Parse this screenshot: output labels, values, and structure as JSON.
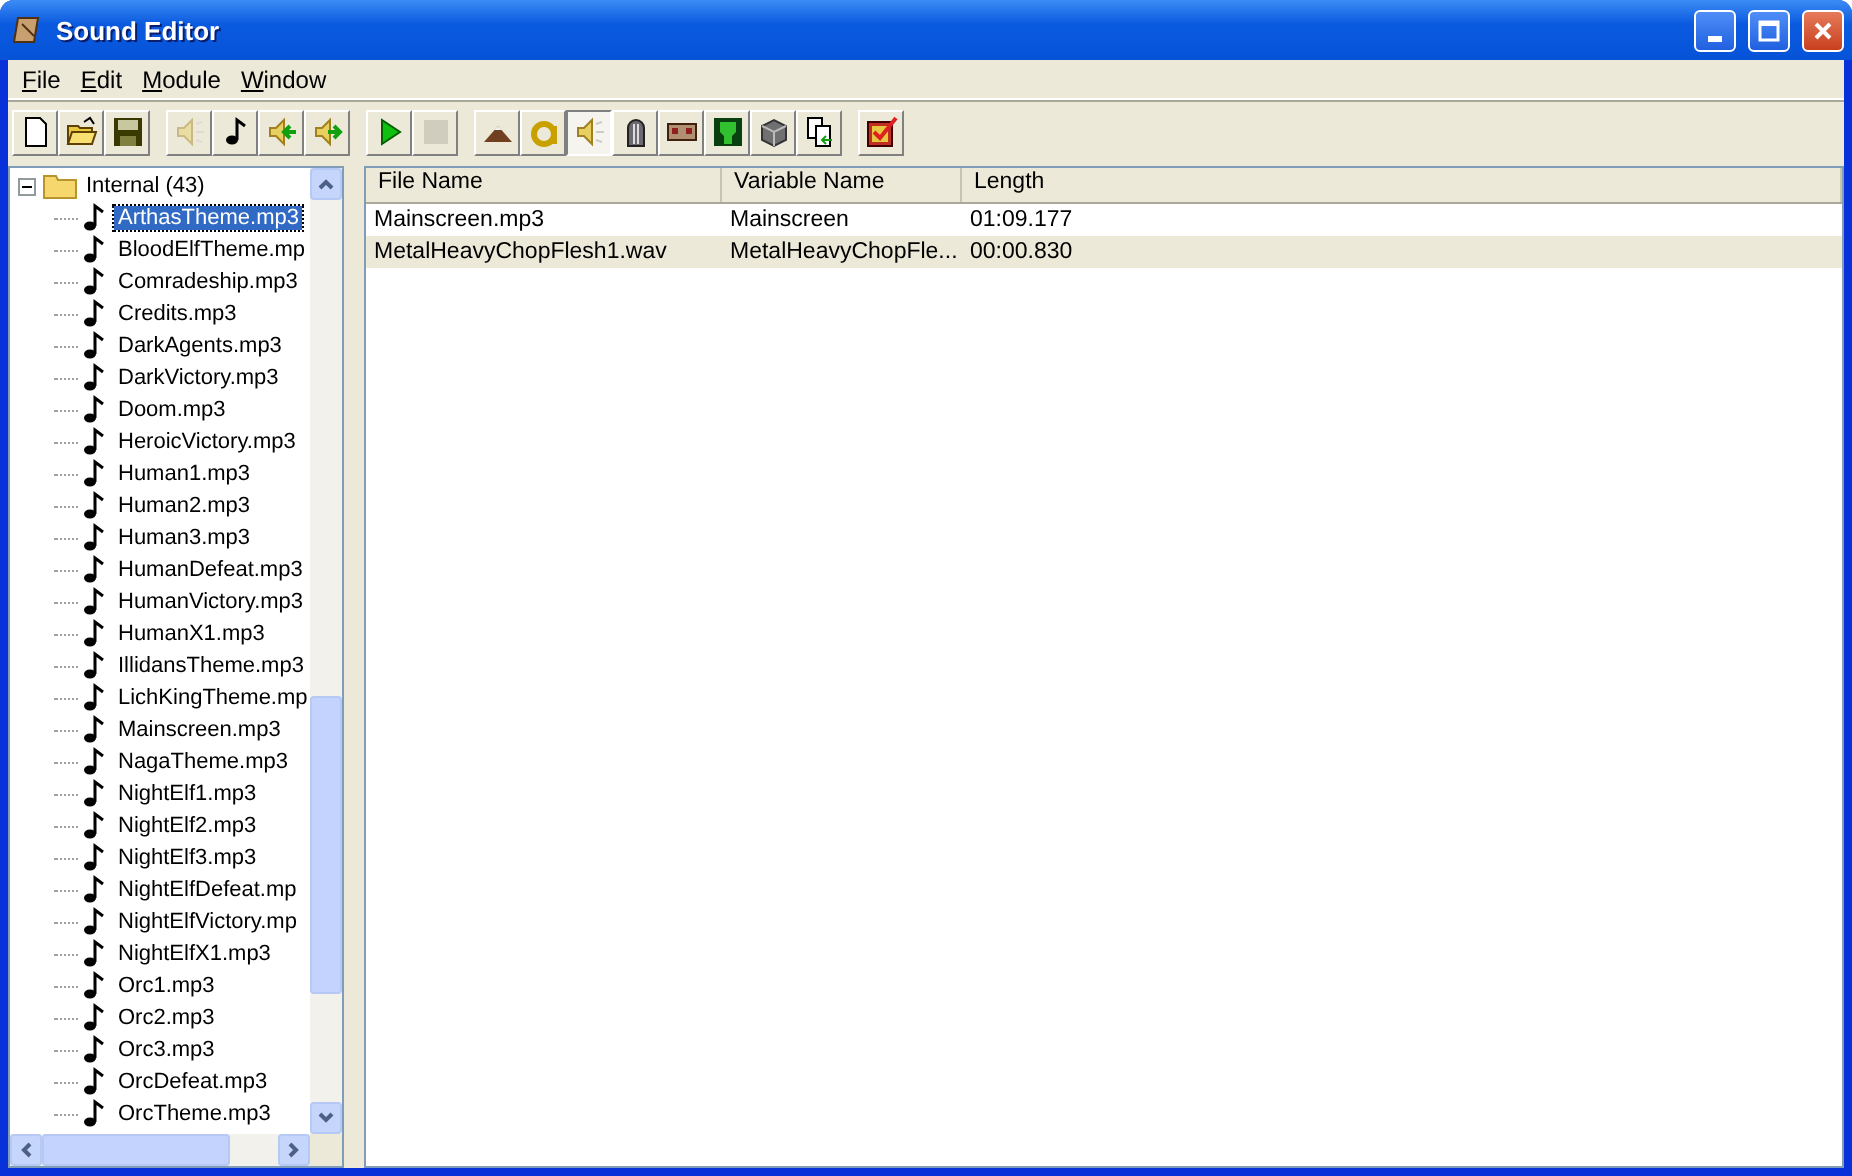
{
  "window": {
    "title": "Sound Editor"
  },
  "menu": [
    {
      "mnemonic": "F",
      "rest": "ile"
    },
    {
      "mnemonic": "E",
      "rest": "dit"
    },
    {
      "mnemonic": "M",
      "rest": "odule"
    },
    {
      "mnemonic": "W",
      "rest": "indow"
    }
  ],
  "toolbar": [
    [
      {
        "disabled": false,
        "pressed": false
      },
      {
        "disabled": false,
        "pressed": false
      },
      {
        "disabled": false,
        "pressed": false
      }
    ],
    [
      {
        "disabled": true,
        "pressed": false
      },
      {
        "disabled": false,
        "pressed": false
      },
      {
        "disabled": false,
        "pressed": false
      },
      {
        "disabled": false,
        "pressed": false
      }
    ],
    [
      {
        "disabled": false,
        "pressed": false
      },
      {
        "disabled": true,
        "pressed": false
      }
    ],
    [
      {
        "disabled": false,
        "pressed": false
      },
      {
        "disabled": false,
        "pressed": false
      },
      {
        "disabled": false,
        "pressed": true
      },
      {
        "disabled": false,
        "pressed": false
      },
      {
        "disabled": false,
        "pressed": false
      },
      {
        "disabled": false,
        "pressed": false
      },
      {
        "disabled": false,
        "pressed": false
      },
      {
        "disabled": false,
        "pressed": false
      }
    ],
    [
      {
        "disabled": false,
        "pressed": false
      }
    ]
  ],
  "tree": {
    "label": "Internal (43)",
    "expanded": true,
    "children": [
      {
        "label": "ArthasTheme.mp3",
        "selected": true
      },
      {
        "label": "BloodElfTheme.mp",
        "selected": false
      },
      {
        "label": "Comradeship.mp3",
        "selected": false
      },
      {
        "label": "Credits.mp3",
        "selected": false
      },
      {
        "label": "DarkAgents.mp3",
        "selected": false
      },
      {
        "label": "DarkVictory.mp3",
        "selected": false
      },
      {
        "label": "Doom.mp3",
        "selected": false
      },
      {
        "label": "HeroicVictory.mp3",
        "selected": false
      },
      {
        "label": "Human1.mp3",
        "selected": false
      },
      {
        "label": "Human2.mp3",
        "selected": false
      },
      {
        "label": "Human3.mp3",
        "selected": false
      },
      {
        "label": "HumanDefeat.mp3",
        "selected": false
      },
      {
        "label": "HumanVictory.mp3",
        "selected": false
      },
      {
        "label": "HumanX1.mp3",
        "selected": false
      },
      {
        "label": "IllidansTheme.mp3",
        "selected": false
      },
      {
        "label": "LichKingTheme.mp",
        "selected": false
      },
      {
        "label": "Mainscreen.mp3",
        "selected": false
      },
      {
        "label": "NagaTheme.mp3",
        "selected": false
      },
      {
        "label": "NightElf1.mp3",
        "selected": false
      },
      {
        "label": "NightElf2.mp3",
        "selected": false
      },
      {
        "label": "NightElf3.mp3",
        "selected": false
      },
      {
        "label": "NightElfDefeat.mp",
        "selected": false
      },
      {
        "label": "NightElfVictory.mp",
        "selected": false
      },
      {
        "label": "NightElfX1.mp3",
        "selected": false
      },
      {
        "label": "Orc1.mp3",
        "selected": false
      },
      {
        "label": "Orc2.mp3",
        "selected": false
      },
      {
        "label": "Orc3.mp3",
        "selected": false
      },
      {
        "label": "OrcDefeat.mp3",
        "selected": false
      },
      {
        "label": "OrcTheme.mp3",
        "selected": false
      }
    ]
  },
  "table": {
    "columns": [
      "File Name",
      "Variable Name",
      "Length"
    ],
    "rows": [
      {
        "cells": [
          "Mainscreen.mp3",
          "Mainscreen",
          "01:09.177"
        ],
        "selected": false
      },
      {
        "cells": [
          "MetalHeavyChopFlesh1.wav",
          "MetalHeavyChopFle...",
          "00:00.830"
        ],
        "selected": true
      }
    ]
  }
}
